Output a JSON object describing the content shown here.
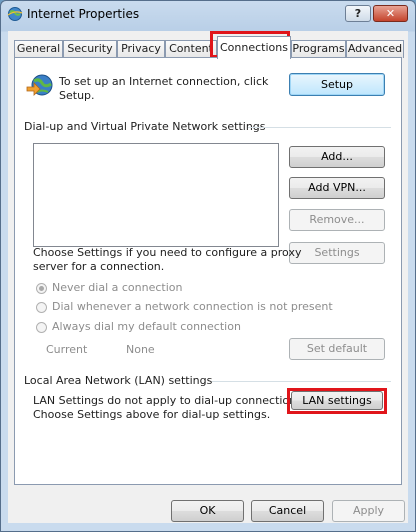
{
  "window": {
    "title": "Internet Properties",
    "help_label": "?",
    "close_label": "✕"
  },
  "tabs": [
    {
      "label": "General"
    },
    {
      "label": "Security"
    },
    {
      "label": "Privacy"
    },
    {
      "label": "Content"
    },
    {
      "label": "Connections",
      "selected": true
    },
    {
      "label": "Programs"
    },
    {
      "label": "Advanced"
    }
  ],
  "setup": {
    "text_line1": "To set up an Internet connection, click",
    "text_line2": "Setup.",
    "button": "Setup"
  },
  "dialup": {
    "group_title": "Dial-up and Virtual Private Network settings",
    "add_button": "Add...",
    "add_vpn_button": "Add VPN...",
    "remove_button": "Remove...",
    "settings_button": "Settings",
    "proxy_text_line1": "Choose Settings if you need to configure a proxy",
    "proxy_text_line2": "server for a connection.",
    "radio_never": "Never dial a connection",
    "radio_whenever": "Dial whenever a network connection is not present",
    "radio_always": "Always dial my default connection",
    "current_label": "Current",
    "current_value": "None",
    "set_default_button": "Set default"
  },
  "lan": {
    "group_title": "Local Area Network (LAN) settings",
    "text_line1": "LAN Settings do not apply to dial-up connections.",
    "text_line2": "Choose Settings above for dial-up settings.",
    "button": "LAN settings"
  },
  "footer": {
    "ok": "OK",
    "cancel": "Cancel",
    "apply": "Apply"
  },
  "colors": {
    "highlight": "#e0151b"
  }
}
